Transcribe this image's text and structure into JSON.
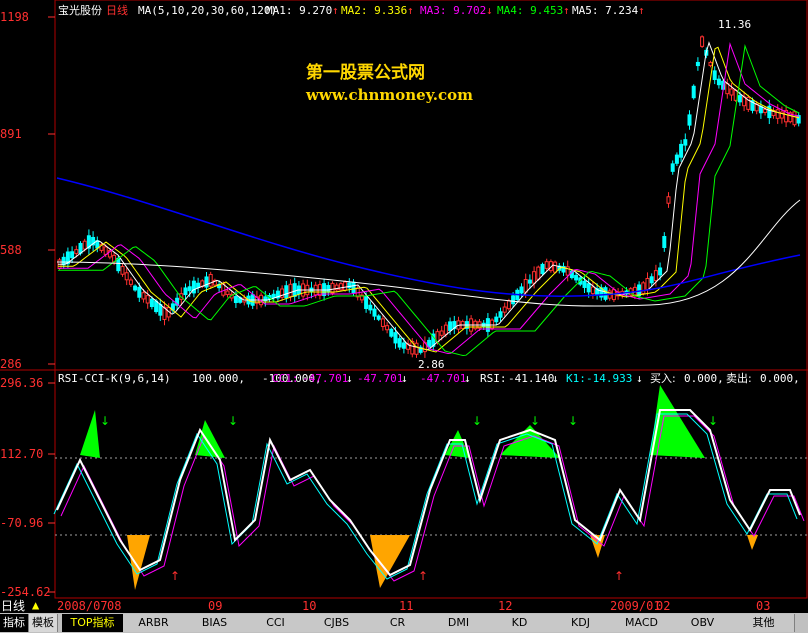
{
  "main": {
    "stock_name": "宝光股份",
    "period": "日线",
    "ma_params": "MA(5,10,20,30,60,120)",
    "ma_values": [
      {
        "label": "MA1:",
        "value": "9.270",
        "arrow": "↑",
        "color": "#ffffff"
      },
      {
        "label": "MA2:",
        "value": "9.336",
        "arrow": "↑",
        "color": "#ffff00"
      },
      {
        "label": "MA3:",
        "value": "9.702",
        "arrow": "↓",
        "color": "#ff00ff"
      },
      {
        "label": "MA4:",
        "value": "9.453",
        "arrow": "↑",
        "color": "#00ff00"
      },
      {
        "label": "MA5:",
        "value": "7.234",
        "arrow": "↑",
        "color": "#ffffff"
      }
    ],
    "y_ticks": [
      "1198",
      "891",
      "588",
      "286"
    ],
    "high_label": "11.36",
    "low_label": "2.86",
    "watermark_title": "第一股票公式网",
    "watermark_url": "www.chnmoney.com"
  },
  "indicator": {
    "title": "RSI-CCI-K(9,6,14)",
    "values": [
      "100.000,",
      "-100.000,"
    ],
    "cc1_label": "CC1:",
    "cc1_values": [
      "-47.701",
      "-47.701",
      "-47.701"
    ],
    "rsi_label": "RSI:",
    "rsi_value": "-41.140",
    "k1_label": "K1:",
    "k1_value": "-14.933",
    "buy_label": "买入:",
    "buy_value": "0.000,",
    "sell_label": "卖出:",
    "sell_value": "0.000,",
    "y_ticks": [
      "296.36",
      "112.70",
      "-70.96",
      "-254.62"
    ]
  },
  "date_axis": {
    "period_label": "日线",
    "labels": [
      "2008/07",
      "08",
      "09",
      "10",
      "11",
      "12",
      "2009/01",
      "02",
      "03"
    ]
  },
  "tabs": {
    "modes": [
      "指标",
      "模板"
    ],
    "items": [
      "TOP指标",
      "ARBR",
      "BIAS",
      "CCI",
      "CJBS",
      "CR",
      "DMI",
      "KD",
      "KDJ",
      "MACD",
      "OBV",
      "其他"
    ]
  },
  "colors": {
    "up": "#ff3030",
    "down": "#00ffff",
    "ma_long": "#0000ff",
    "fill_green": "#00ff00",
    "fill_orange": "#ffa500"
  }
}
